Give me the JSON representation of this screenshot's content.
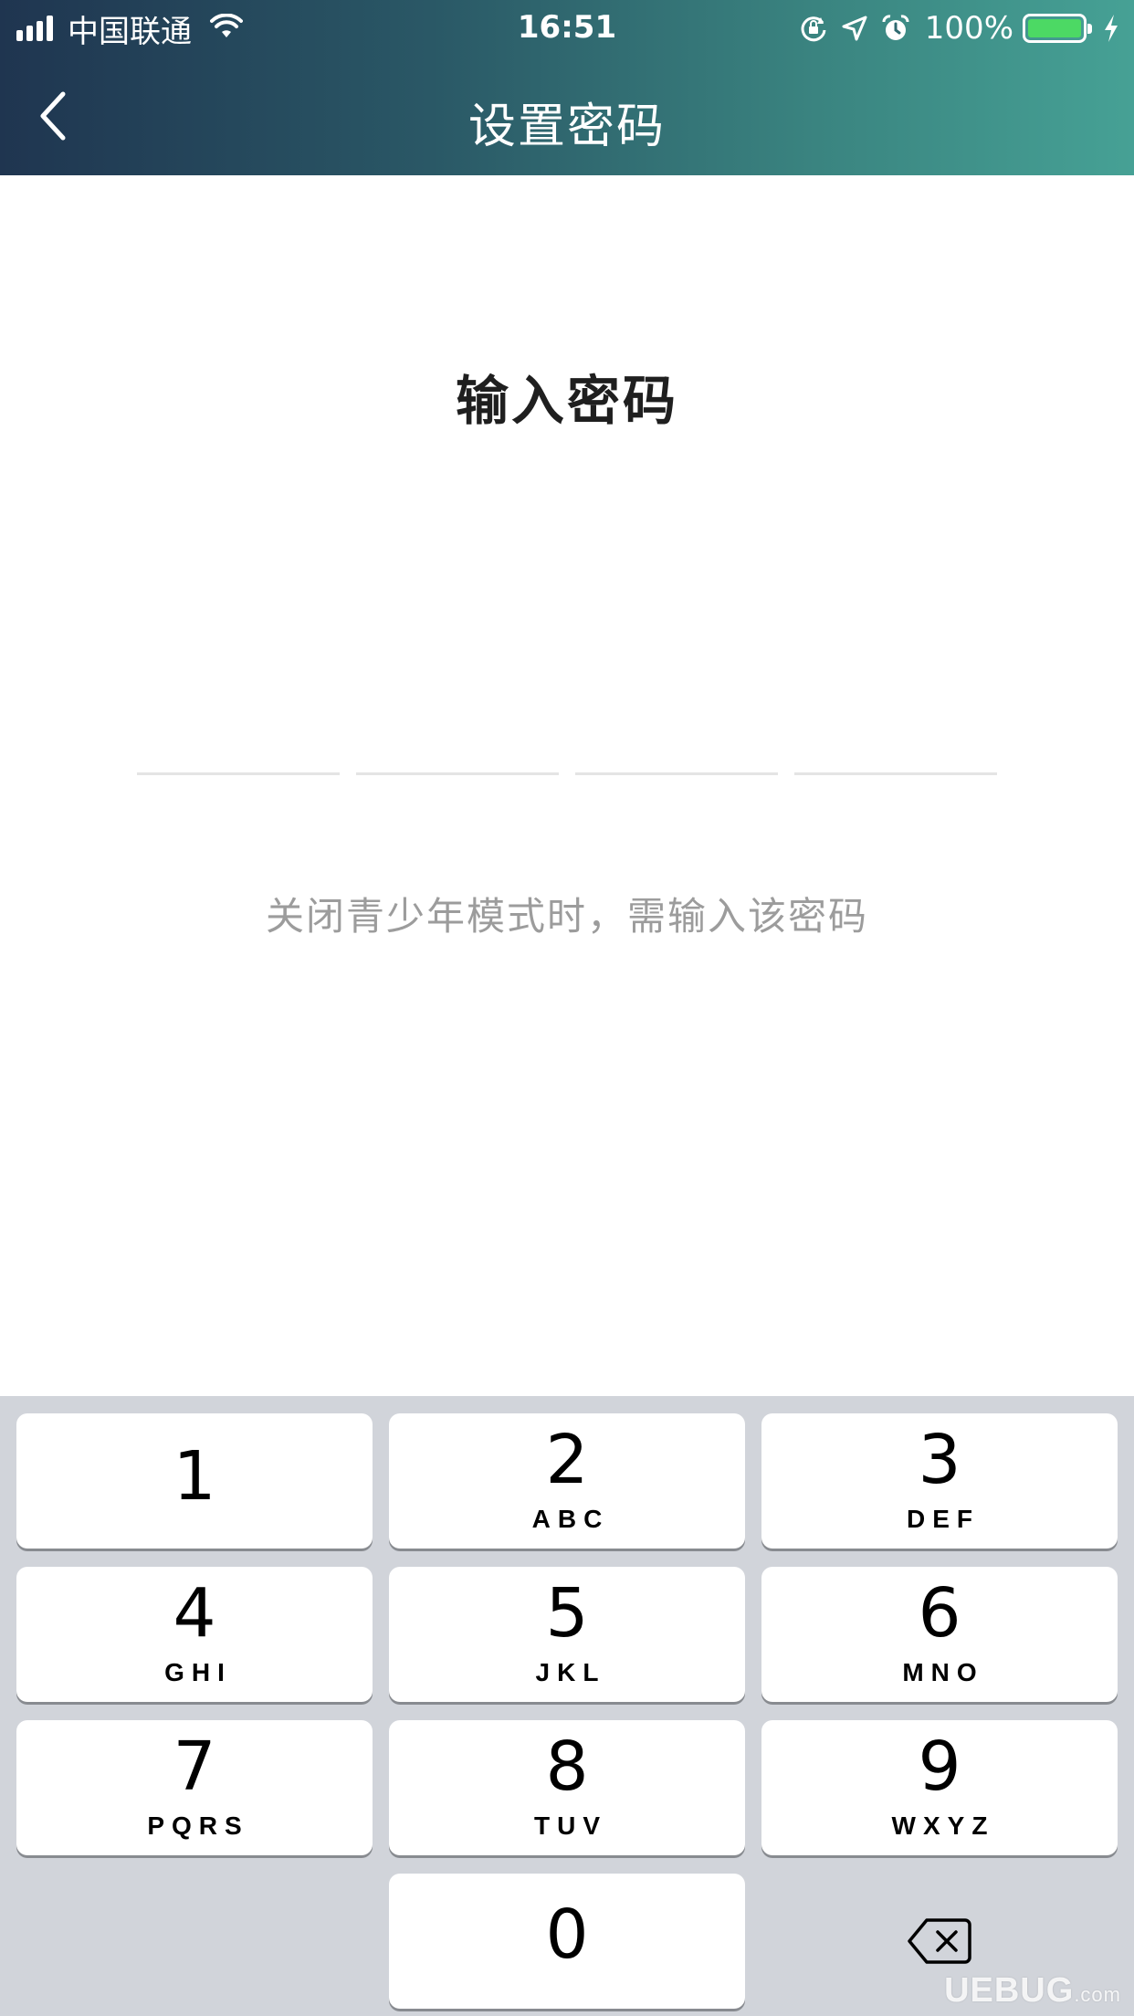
{
  "status_bar": {
    "carrier": "中国联通",
    "time": "16:51",
    "battery_percent": "100%",
    "battery_level": 1.0,
    "icons": [
      "signal-icon",
      "wifi-icon",
      "orientation-lock-icon",
      "location-icon",
      "alarm-icon",
      "battery-icon",
      "charging-icon"
    ]
  },
  "nav": {
    "title": "设置密码",
    "back_icon": "chevron-left-icon"
  },
  "main": {
    "title": "输入密码",
    "pin_length": 4,
    "hint": "关闭青少年模式时，需输入该密码"
  },
  "keypad": {
    "keys": [
      {
        "digit": "1",
        "letters": ""
      },
      {
        "digit": "2",
        "letters": "ABC"
      },
      {
        "digit": "3",
        "letters": "DEF"
      },
      {
        "digit": "4",
        "letters": "GHI"
      },
      {
        "digit": "5",
        "letters": "JKL"
      },
      {
        "digit": "6",
        "letters": "MNO"
      },
      {
        "digit": "7",
        "letters": "PQRS"
      },
      {
        "digit": "8",
        "letters": "TUV"
      },
      {
        "digit": "9",
        "letters": "WXYZ"
      },
      {
        "digit": "0",
        "letters": ""
      }
    ],
    "delete_icon": "backspace-icon"
  },
  "watermark": {
    "text": "UEBUG",
    "suffix": ".com"
  },
  "colors": {
    "header_gradient_start": "#1f3550",
    "header_gradient_end": "#46a195",
    "keypad_background": "#d1d4da",
    "hint_text": "#9c9c9c",
    "battery_fill": "#4cd964"
  }
}
